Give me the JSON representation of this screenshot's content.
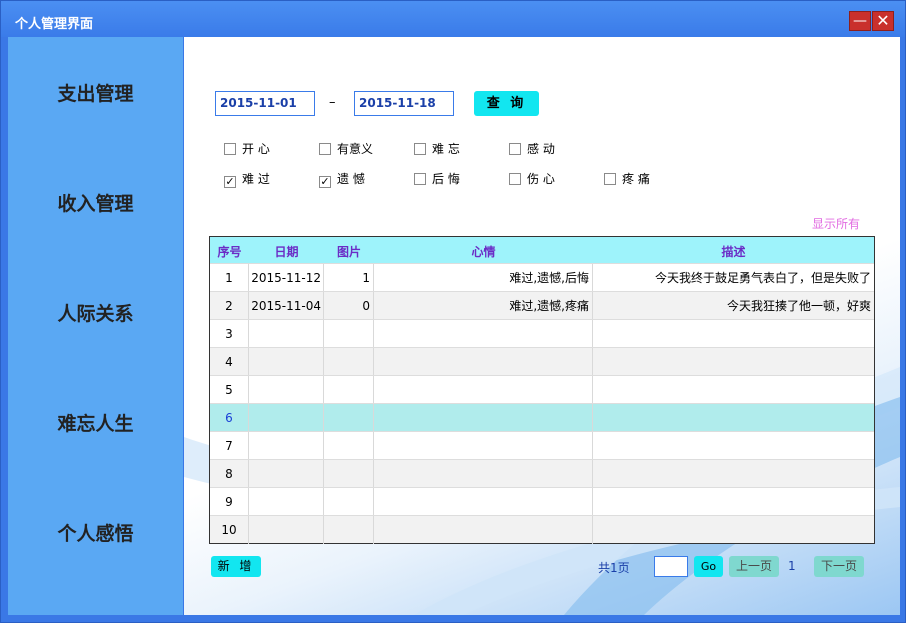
{
  "window": {
    "title": "个人管理界面",
    "minimize_glyph": "—",
    "close_glyph": "✕"
  },
  "sidebar": {
    "items": [
      {
        "label": "支出管理"
      },
      {
        "label": "收入管理"
      },
      {
        "label": "人际关系"
      },
      {
        "label": "难忘人生"
      },
      {
        "label": "个人感悟"
      }
    ]
  },
  "filter": {
    "start_date": "2015-11-01",
    "separator": "–",
    "end_date": "2015-11-18",
    "query_label": "查 询"
  },
  "moods": [
    {
      "label": "开 心",
      "checked": false
    },
    {
      "label": "有意义",
      "checked": false
    },
    {
      "label": "难 忘",
      "checked": false
    },
    {
      "label": "感 动",
      "checked": false
    },
    {
      "label": "难 过",
      "checked": true
    },
    {
      "label": "遗 憾",
      "checked": true
    },
    {
      "label": "后 悔",
      "checked": false
    },
    {
      "label": "伤 心",
      "checked": false
    },
    {
      "label": "疼 痛",
      "checked": false
    }
  ],
  "show_all_label": "显示所有",
  "table": {
    "headers": [
      "序号",
      "日期",
      "图片",
      "心情",
      "描述"
    ],
    "rows": [
      {
        "no": "1",
        "date": "2015-11-12",
        "pic": "1",
        "mood": "难过,遗憾,后悔",
        "desc": "今天我终于鼓足勇气表白了，但是失败了"
      },
      {
        "no": "2",
        "date": "2015-11-04",
        "pic": "0",
        "mood": "难过,遗憾,疼痛",
        "desc": "今天我狂揍了他一顿，好爽"
      },
      {
        "no": "3",
        "date": "",
        "pic": "",
        "mood": "",
        "desc": ""
      },
      {
        "no": "4",
        "date": "",
        "pic": "",
        "mood": "",
        "desc": ""
      },
      {
        "no": "5",
        "date": "",
        "pic": "",
        "mood": "",
        "desc": ""
      },
      {
        "no": "6",
        "date": "",
        "pic": "",
        "mood": "",
        "desc": ""
      },
      {
        "no": "7",
        "date": "",
        "pic": "",
        "mood": "",
        "desc": ""
      },
      {
        "no": "8",
        "date": "",
        "pic": "",
        "mood": "",
        "desc": ""
      },
      {
        "no": "9",
        "date": "",
        "pic": "",
        "mood": "",
        "desc": ""
      },
      {
        "no": "10",
        "date": "",
        "pic": "",
        "mood": "",
        "desc": ""
      }
    ],
    "selected_row": 6
  },
  "footer": {
    "add_label": "新 增",
    "total_pages": "共1页",
    "go_label": "Go",
    "prev_label": "上一页",
    "current_page": "1",
    "next_label": "下一页"
  },
  "colors": {
    "titlebar": "#3a7be9",
    "sidebar": "#5aa8f3",
    "button_cyan": "#12e6f0",
    "header_bg": "#9ef3fb",
    "header_text": "#6b2cc6",
    "selected_row": "#b0ecec",
    "show_all_text": "#e26ce2",
    "close_button": "#c9302c"
  }
}
